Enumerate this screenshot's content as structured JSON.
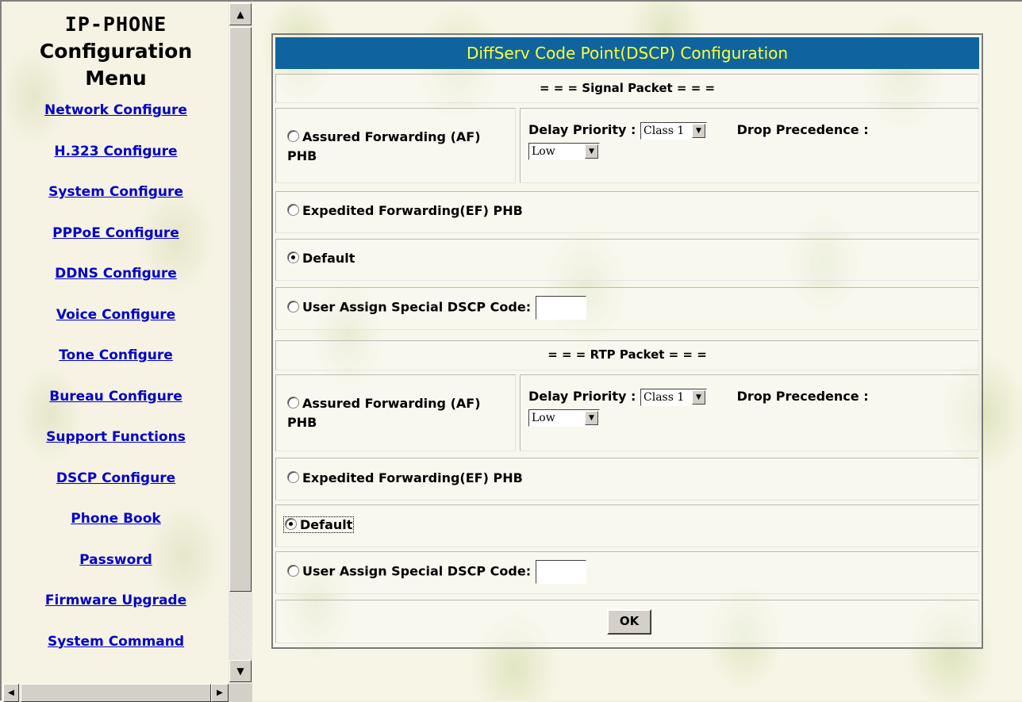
{
  "menu": {
    "title_line1": "IP-PHONE",
    "title_line2": "Configuration",
    "title_line3": "Menu",
    "items": [
      {
        "label": "Network Configure"
      },
      {
        "label": "H.323 Configure"
      },
      {
        "label": "System Configure"
      },
      {
        "label": "PPPoE Configure"
      },
      {
        "label": "DDNS Configure"
      },
      {
        "label": "Voice Configure"
      },
      {
        "label": "Tone Configure"
      },
      {
        "label": "Bureau Configure"
      },
      {
        "label": "Support Functions"
      },
      {
        "label": "DSCP Configure"
      },
      {
        "label": "Phone Book"
      },
      {
        "label": "Password"
      },
      {
        "label": "Firmware Upgrade"
      },
      {
        "label": "System Command"
      }
    ]
  },
  "panel": {
    "title": "DiffServ Code Point(DSCP) Configuration",
    "signal": {
      "section_label": "= = = Signal Packet = = =",
      "af_label": "Assured Forwarding (AF) PHB",
      "delay_priority_label": "Delay Priority :",
      "delay_priority_value": "Class 1",
      "drop_precedence_label": "Drop Precedence :",
      "drop_precedence_value": "Low",
      "ef_label": "Expedited Forwarding(EF) PHB",
      "default_label": "Default",
      "user_assign_label": "User Assign Special DSCP Code:",
      "user_assign_value": "",
      "selected": "default"
    },
    "rtp": {
      "section_label": "= = = RTP Packet = = =",
      "af_label": "Assured Forwarding (AF) PHB",
      "delay_priority_label": "Delay Priority :",
      "delay_priority_value": "Class 1",
      "drop_precedence_label": "Drop Precedence :",
      "drop_precedence_value": "Low",
      "ef_label": "Expedited Forwarding(EF) PHB",
      "default_label": "Default",
      "user_assign_label": "User Assign Special DSCP Code:",
      "user_assign_value": "",
      "selected": "default"
    },
    "ok_label": "OK"
  },
  "colors": {
    "header_bg": "#0f64a0",
    "header_text": "#ffff33",
    "link": "#0000cc"
  }
}
